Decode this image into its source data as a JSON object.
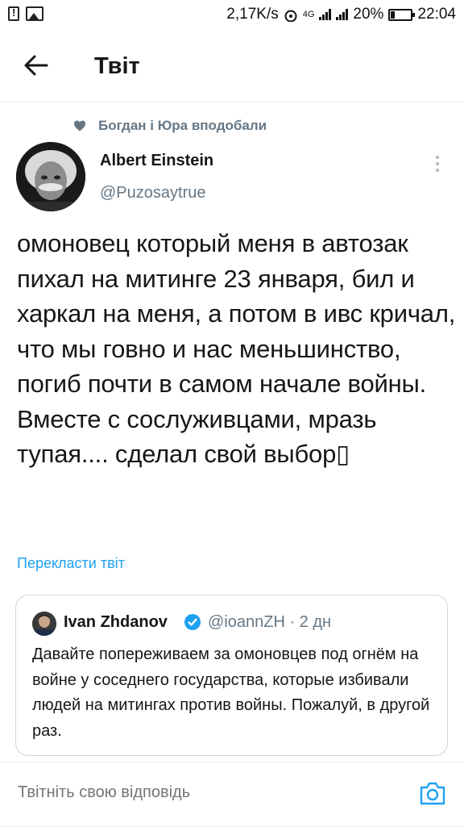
{
  "status_bar": {
    "network_speed": "2,17K/s",
    "network_type": "4G",
    "battery_percent": "20%",
    "time": "22:04"
  },
  "header": {
    "title": "Твіт"
  },
  "liked_by": "Богдан і Юра вподобали",
  "tweet": {
    "author_name": "Albert Einstein",
    "author_handle": "@Puzosaytrue",
    "text": "омоновец который меня в автозак пихал на митинге 23 января, бил и харкал на меня, а потом в ивс кричал, что мы говно и нас меньшинство, погиб почти в самом начале войны. Вместе с сослуживцами, мразь тупая.... сделал свой выбор▯",
    "translate_label": "Перекласти твіт"
  },
  "quoted_tweet": {
    "author_name": "Ivan Zhdanov",
    "author_handle": "@ioannZH",
    "separator": "·",
    "time_ago": "2 дн",
    "text": "Давайте попереживаем за омоновцев под огнём на войне у соседнего государства, которые избивали людей на митингах против войны. Пожалуй, в другой раз."
  },
  "reply": {
    "placeholder": "Твітніть свою відповідь"
  },
  "colors": {
    "accent": "#1da1f2",
    "secondary_text": "#657786",
    "primary_text": "#14171a",
    "border": "#ccd6dd"
  },
  "icons": [
    "back-arrow-icon",
    "heart-icon",
    "more-vertical-icon",
    "verified-badge-icon",
    "camera-icon"
  ]
}
